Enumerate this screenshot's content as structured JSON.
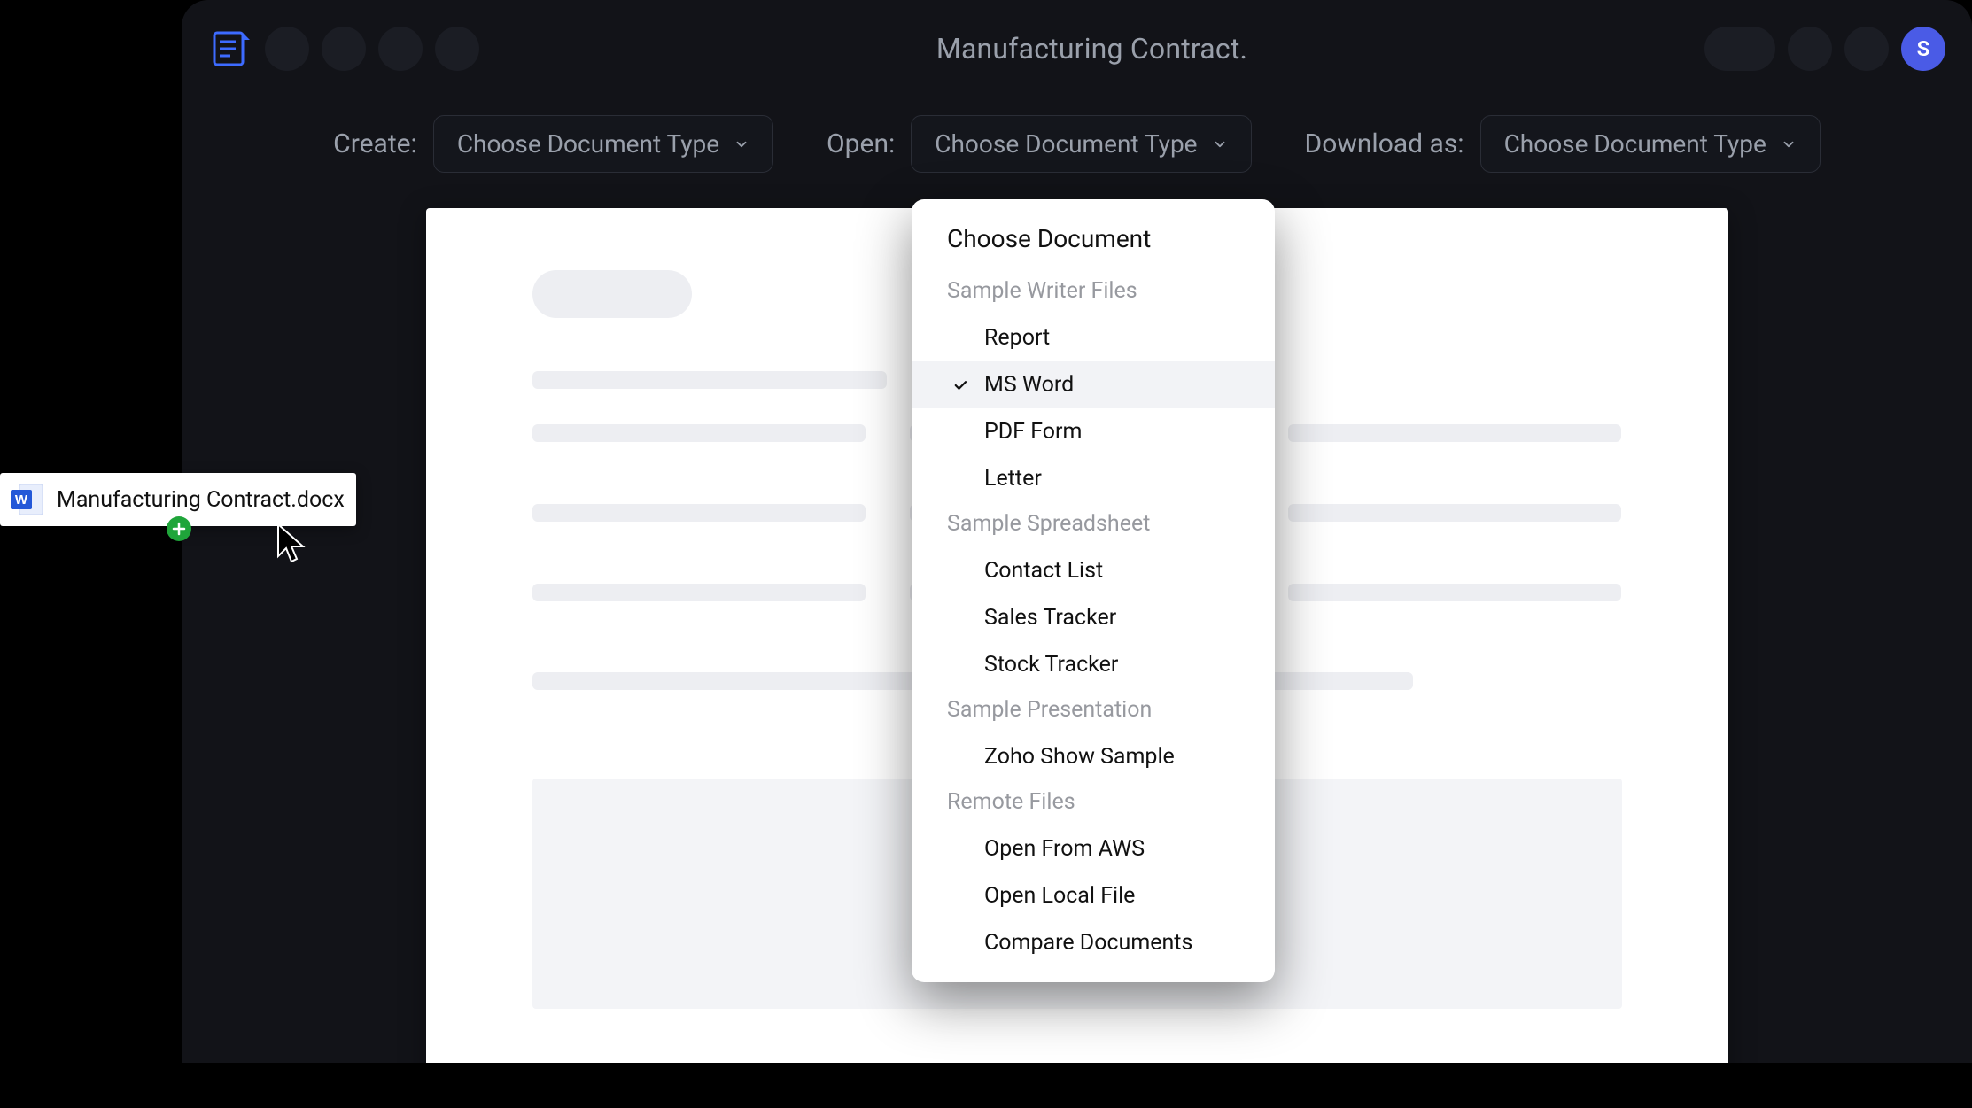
{
  "header": {
    "title": "Manufacturing Contract.",
    "avatar_initial": "S"
  },
  "toolbar": {
    "create": {
      "label": "Create:",
      "select": "Choose Document Type"
    },
    "open": {
      "label": "Open:",
      "select": "Choose Document Type"
    },
    "download": {
      "label": "Download as:",
      "select": "Choose Document Type"
    }
  },
  "dropdown": {
    "title": "Choose Document",
    "sections": [
      {
        "title": "Sample Writer Files",
        "items": [
          "Report",
          "MS Word",
          "PDF Form",
          "Letter"
        ],
        "selected": "MS Word"
      },
      {
        "title": "Sample  Spreadsheet",
        "items": [
          "Contact List",
          "Sales Tracker",
          "Stock Tracker"
        ]
      },
      {
        "title": "Sample  Presentation",
        "items": [
          "Zoho Show Sample"
        ]
      },
      {
        "title": "Remote Files",
        "items": [
          "Open From AWS",
          "Open Local File",
          "Compare Documents"
        ]
      }
    ]
  },
  "drag_file": {
    "name": "Manufacturing Contract.docx"
  }
}
